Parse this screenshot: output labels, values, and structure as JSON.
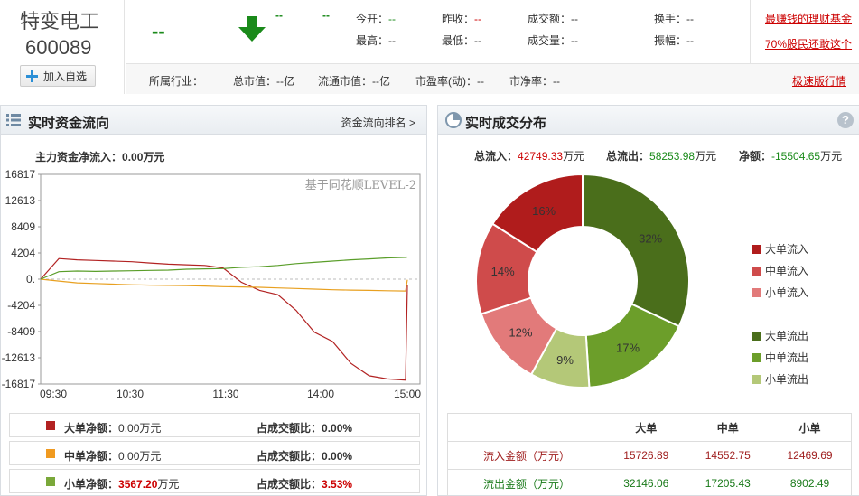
{
  "stock": {
    "name": "特变电工",
    "code": "600089",
    "add_label": "加入自选"
  },
  "quote": {
    "price": "--",
    "change": "--",
    "change_pct": "--",
    "items": [
      {
        "label": "今开：",
        "value": "--",
        "color": "#1a8a1a"
      },
      {
        "label": "最高：",
        "value": "--",
        "color": "#333333"
      },
      {
        "label": "昨收：",
        "value": "--",
        "color": "#cc0000"
      },
      {
        "label": "最低：",
        "value": "--",
        "color": "#333333"
      },
      {
        "label": "成交额：",
        "value": "--",
        "color": "#333333"
      },
      {
        "label": "成交量：",
        "value": "--",
        "color": "#333333"
      },
      {
        "label": "换手：",
        "value": "--",
        "color": "#333333"
      },
      {
        "label": "振幅：",
        "value": "--",
        "color": "#333333"
      }
    ]
  },
  "links": {
    "fund": "最赚钱的理财基金",
    "investor": "70%股民还敢这个",
    "fast": "极速版行情"
  },
  "row2": {
    "industry": "所属行业：",
    "total_mv": "总市值：--亿",
    "float_mv": "流通市值：--亿",
    "pe": "市盈率(动)：--",
    "pb": "市净率：--"
  },
  "left_panel": {
    "title": "实时资金流向",
    "rank_link": "资金流向排名 >",
    "net_label": "主力资金净流入：",
    "net_value": "0.00万元",
    "watermark": "基于同花顺LEVEL-2"
  },
  "chart_data": {
    "type": "line",
    "y_ticks": [
      "16817",
      "12613",
      "8409",
      "4204",
      "0.",
      "-4204",
      "-8409",
      "-12613",
      "-16817"
    ],
    "x_ticks": [
      "09:30",
      "10:30",
      "11:30",
      "14:00",
      "15:00"
    ],
    "ylim": [
      -16817,
      16817
    ],
    "grid": false,
    "series": [
      {
        "color": "#b22222",
        "values": [
          0,
          3300,
          3100,
          3000,
          2900,
          2800,
          2600,
          2400,
          2300,
          2200,
          1800,
          -500,
          -1800,
          -2500,
          -5000,
          -8500,
          -10000,
          -13500,
          -15500,
          -16000,
          -16200,
          -1000
        ]
      },
      {
        "color": "#e8a020",
        "values": [
          0,
          -300,
          -600,
          -700,
          -800,
          -900,
          -950,
          -1000,
          -1050,
          -1100,
          -1200,
          -1250,
          -1300,
          -1400,
          -1500,
          -1600,
          -1700,
          -1750,
          -1800,
          -1850,
          -1900,
          -100
        ]
      },
      {
        "color": "#5a9e2a",
        "values": [
          0,
          1200,
          1300,
          1250,
          1300,
          1350,
          1400,
          1450,
          1600,
          1650,
          1700,
          1900,
          2000,
          2200,
          2500,
          2700,
          2900,
          3100,
          3250,
          3400,
          3500,
          3550
        ]
      }
    ]
  },
  "left_legend": [
    {
      "swatch": "#b22222",
      "label": "大单净额：",
      "value": "0.00",
      "unit": "万元",
      "ratio_label": "占成交额比：",
      "ratio": "0.00%",
      "highlight": false
    },
    {
      "swatch": "#f09a20",
      "label": "中单净额：",
      "value": "0.00",
      "unit": "万元",
      "ratio_label": "占成交额比：",
      "ratio": "0.00%",
      "highlight": false
    },
    {
      "swatch": "#7aa83a",
      "label": "小单净额：",
      "value": "3567.20",
      "unit": "万元",
      "ratio_label": "占成交额比：",
      "ratio": "3.53%",
      "highlight": true
    }
  ],
  "right_panel": {
    "title": "实时成交分布",
    "inflow_label": "总流入：",
    "inflow_value": "42749.33",
    "inflow_unit": "万元",
    "outflow_label": "总流出：",
    "outflow_value": "58253.98",
    "outflow_unit": "万元",
    "net_label": "净额：",
    "net_value": "-15504.65",
    "net_unit": "万元"
  },
  "pie": {
    "slices": [
      {
        "name": "大单流出",
        "pct": 32,
        "label": "32%",
        "color": "#4a6e1b"
      },
      {
        "name": "中单流出",
        "pct": 17,
        "label": "17%",
        "color": "#6c9e2a"
      },
      {
        "name": "小单流出",
        "pct": 9,
        "label": "9%",
        "color": "#b4c878"
      },
      {
        "name": "小单流入",
        "pct": 12,
        "label": "12%",
        "color": "#e27a7a"
      },
      {
        "name": "中单流入",
        "pct": 14,
        "label": "14%",
        "color": "#cf4b4b"
      },
      {
        "name": "大单流入",
        "pct": 16,
        "label": "16%",
        "color": "#b01c1c"
      }
    ],
    "legend": [
      {
        "label": "大单流入",
        "color": "#b01c1c"
      },
      {
        "label": "中单流入",
        "color": "#cf4b4b"
      },
      {
        "label": "小单流入",
        "color": "#e27a7a"
      },
      {
        "label": "大单流出",
        "color": "#4a6e1b"
      },
      {
        "label": "中单流出",
        "color": "#6c9e2a"
      },
      {
        "label": "小单流出",
        "color": "#b4c878"
      }
    ]
  },
  "flow_table": {
    "headers": [
      "",
      "大单",
      "中单",
      "小单"
    ],
    "inflow": [
      "流入金额（万元）",
      "15726.89",
      "14552.75",
      "12469.69"
    ],
    "outflow": [
      "流出金额（万元）",
      "32146.06",
      "17205.43",
      "8902.49"
    ]
  }
}
